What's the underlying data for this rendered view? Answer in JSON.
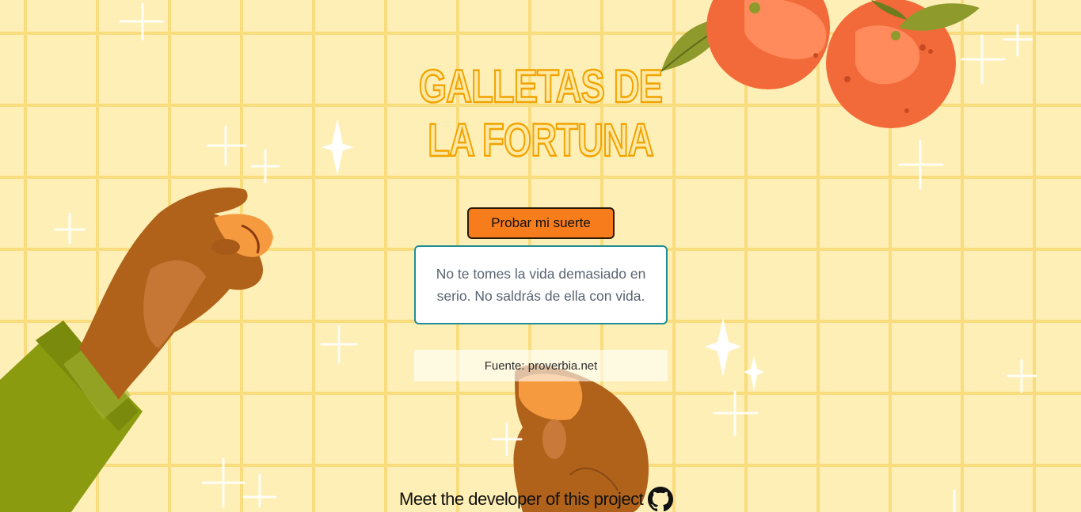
{
  "page": {
    "title": "GALLETAS DE LA FORTUNA"
  },
  "actions": {
    "luck_button_label": "Probar mi suerte"
  },
  "fortune": {
    "quote": "No te tomes la vida demasiado en serio. No saldrás de ella con vida.",
    "source_label": "Fuente: proverbia.net"
  },
  "footer": {
    "developer_link": "Meet the developer of this project",
    "github_icon": "github-icon"
  },
  "colors": {
    "background": "#fdefb5",
    "grid": "#f8dc7e",
    "title_stroke": "#f2a300",
    "button": "#f77c1c",
    "quote_border": "#1f8e97"
  }
}
